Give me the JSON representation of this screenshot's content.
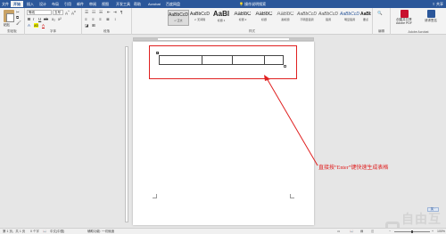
{
  "tabs": [
    "文件",
    "开始",
    "插入",
    "设计",
    "布局",
    "引用",
    "邮件",
    "审阅",
    "视图",
    "开发工具",
    "帮助",
    "Acrobat",
    "百度网盘"
  ],
  "active_tab_index": 1,
  "search": {
    "label": "操作说明搜索"
  },
  "share_label": "共享",
  "ribbon": {
    "clipboard": {
      "paste": "粘贴",
      "label": "剪贴板"
    },
    "font": {
      "name": "等线",
      "size": "五号",
      "label": "字体"
    },
    "paragraph": {
      "label": "段落"
    },
    "styles": {
      "label": "样式",
      "items": [
        {
          "sample": "AaBbCcD",
          "name": "↵ 正文"
        },
        {
          "sample": "AaBbCcD",
          "name": "↵ 无间隔"
        },
        {
          "sample": "AaBl",
          "name": "标题 1"
        },
        {
          "sample": "AaBbC",
          "name": "标题 2"
        },
        {
          "sample": "AaBbC",
          "name": "标题"
        },
        {
          "sample": "AaBbC",
          "name": "副标题"
        },
        {
          "sample": "AaBbCcD",
          "name": "不明显强调"
        },
        {
          "sample": "AaBbCcD",
          "name": "强调"
        },
        {
          "sample": "AaBbCcD",
          "name": "明显强调"
        },
        {
          "sample": "AaBbCcD",
          "name": "要点"
        }
      ]
    },
    "editing": {
      "label": "编辑"
    },
    "acrobat": {
      "create": "创建并共享 Adobe PDF",
      "request": "请求签名",
      "label": "Adobe Acrobat"
    }
  },
  "annotation": {
    "text": "直接按“Enter”键快速生成表格",
    "color": "#e02020"
  },
  "watermark": {
    "text": "自由互联"
  },
  "ime_badge": "英 ·",
  "status": {
    "page": "第 1 页，共 1 页",
    "words": "0 个字",
    "lang": "中文(中国)",
    "accessibility": "辅助功能: 一切就绪",
    "zoom": "100%"
  },
  "colors": {
    "accent": "#2b579a",
    "highlight": "#e02020"
  }
}
